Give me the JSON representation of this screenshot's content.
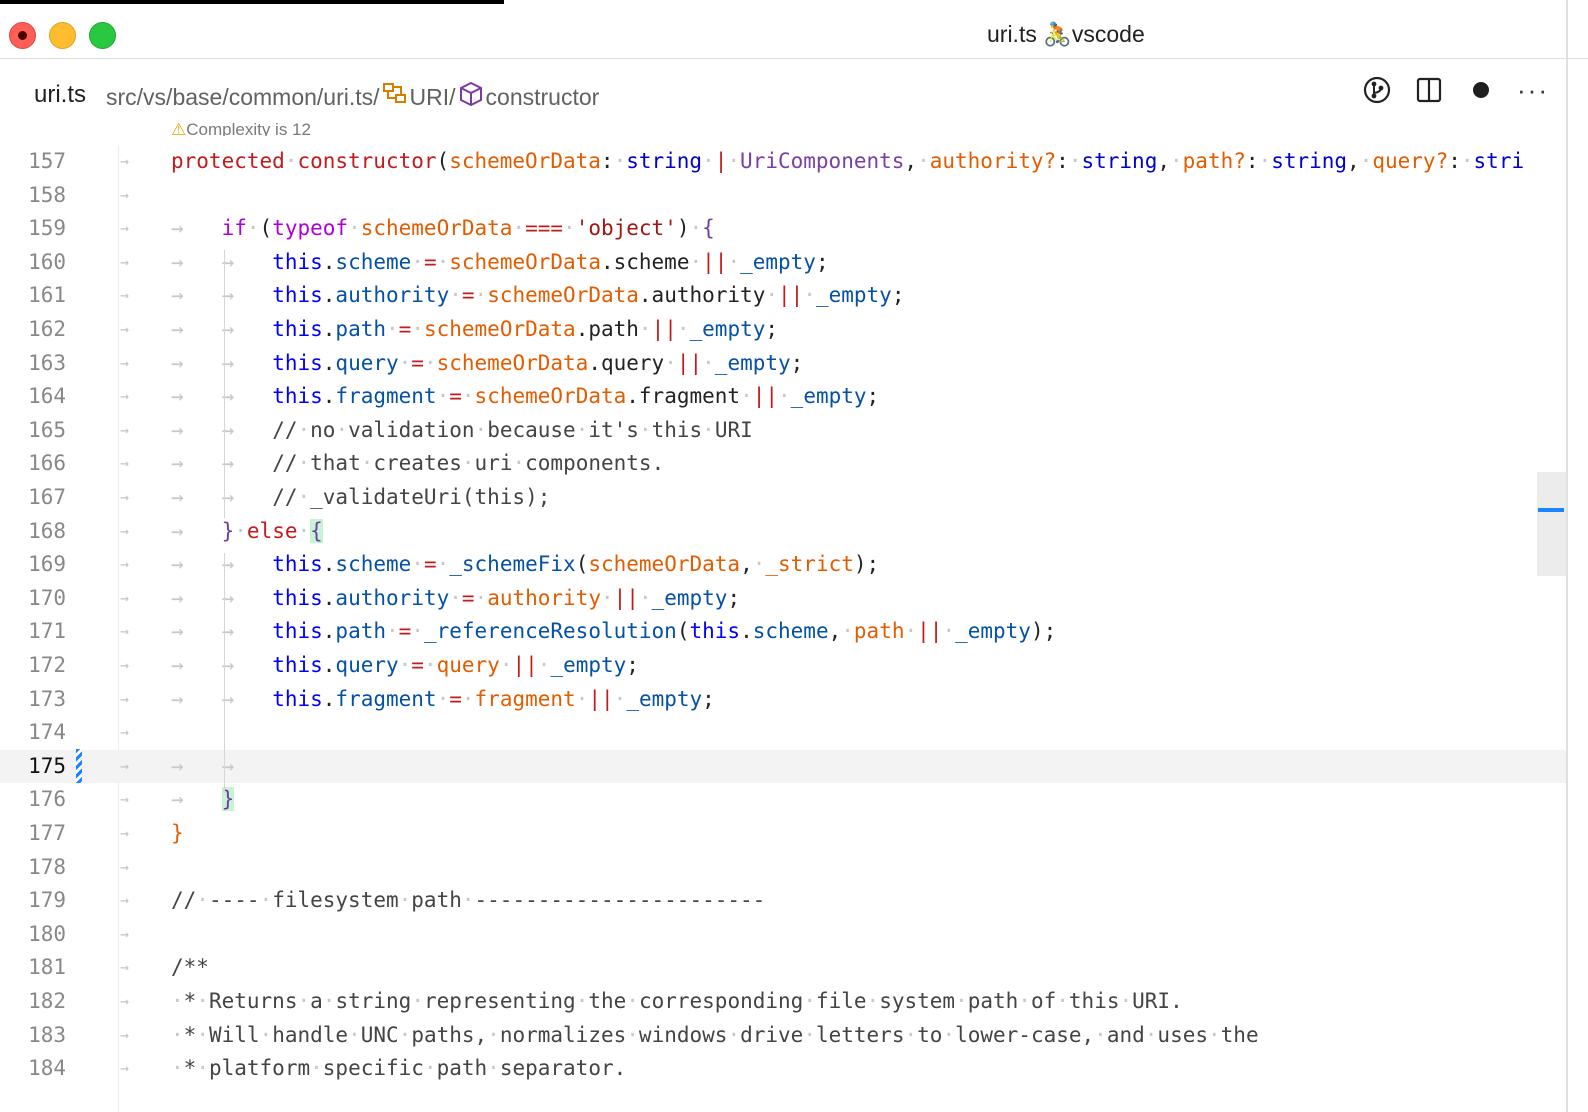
{
  "window": {
    "title": "uri.ts 🚴vscode"
  },
  "tab": {
    "filename": "uri.ts",
    "breadcrumb": {
      "path": "src/vs/base/common/uri.ts/",
      "class_name": "URI/",
      "member_name": "constructor"
    }
  },
  "icons": {
    "breadcrumb_class": "class-icon",
    "breadcrumb_member": "cube-icon",
    "actions": [
      "git-compare-icon",
      "split-editor-icon",
      "unsaved-dot-icon",
      "more-actions-icon"
    ]
  },
  "codelens": "Complexity is 12",
  "editor": {
    "current_line": "175",
    "lines": [
      {
        "n": "157",
        "html": "<span class='kw'>protected</span><span class='ws'>·</span><span class='kw'>constructor</span><span class='d'>(</span><span class='v'>schemeOrData</span><span class='d'>:</span><span class='ws'>·</span><span class='t'>string</span><span class='ws'>·</span><span class='kw'>|</span><span class='ws'>·</span><span class='ty'>UriComponents</span><span class='d'>,</span><span class='ws'>·</span><span class='v'>authority?</span><span class='d'>:</span><span class='ws'>·</span><span class='t'>string</span><span class='d'>,</span><span class='ws'>·</span><span class='v'>path?</span><span class='d'>:</span><span class='ws'>·</span><span class='t'>string</span><span class='d'>,</span><span class='ws'>·</span><span class='v'>query?</span><span class='d'>:</span><span class='ws'>·</span><span class='t'>stri</span>"
      },
      {
        "n": "158",
        "html": ""
      },
      {
        "n": "159",
        "html": "<span class='ws'>→</span>   <span class='k'>if</span><span class='ws'>·</span><span class='d'>(</span><span class='k'>typeof</span><span class='ws'>·</span><span class='v'>schemeOrData</span><span class='ws'>·</span><span class='kw'>===</span><span class='ws'>·</span><span class='s'>'object'</span><span class='d'>)</span><span class='ws'>·</span><span class='br'>{</span>"
      },
      {
        "n": "160",
        "html": "<span class='ws'>→</span>   <span class='ws'>→</span>   <span class='m'>this</span><span class='d'>.</span><span class='p'>scheme</span><span class='ws'>·</span><span class='kw'>=</span><span class='ws'>·</span><span class='v'>schemeOrData</span><span class='d'>.scheme</span><span class='ws'>·</span><span class='kw'>||</span><span class='ws'>·</span><span class='p'>_empty</span><span class='d'>;</span>"
      },
      {
        "n": "161",
        "html": "<span class='ws'>→</span>   <span class='ws'>→</span>   <span class='m'>this</span><span class='d'>.</span><span class='p'>authority</span><span class='ws'>·</span><span class='kw'>=</span><span class='ws'>·</span><span class='v'>schemeOrData</span><span class='d'>.authority</span><span class='ws'>·</span><span class='kw'>||</span><span class='ws'>·</span><span class='p'>_empty</span><span class='d'>;</span>"
      },
      {
        "n": "162",
        "html": "<span class='ws'>→</span>   <span class='ws'>→</span>   <span class='m'>this</span><span class='d'>.</span><span class='p'>path</span><span class='ws'>·</span><span class='kw'>=</span><span class='ws'>·</span><span class='v'>schemeOrData</span><span class='d'>.path</span><span class='ws'>·</span><span class='kw'>||</span><span class='ws'>·</span><span class='p'>_empty</span><span class='d'>;</span>"
      },
      {
        "n": "163",
        "html": "<span class='ws'>→</span>   <span class='ws'>→</span>   <span class='m'>this</span><span class='d'>.</span><span class='p'>query</span><span class='ws'>·</span><span class='kw'>=</span><span class='ws'>·</span><span class='v'>schemeOrData</span><span class='d'>.query</span><span class='ws'>·</span><span class='kw'>||</span><span class='ws'>·</span><span class='p'>_empty</span><span class='d'>;</span>"
      },
      {
        "n": "164",
        "html": "<span class='ws'>→</span>   <span class='ws'>→</span>   <span class='m'>this</span><span class='d'>.</span><span class='p'>fragment</span><span class='ws'>·</span><span class='kw'>=</span><span class='ws'>·</span><span class='v'>schemeOrData</span><span class='d'>.fragment</span><span class='ws'>·</span><span class='kw'>||</span><span class='ws'>·</span><span class='p'>_empty</span><span class='d'>;</span>"
      },
      {
        "n": "165",
        "html": "<span class='ws'>→</span>   <span class='ws'>→</span>   <span class='c'>//</span><span class='ws'>·</span><span class='c'>no</span><span class='ws'>·</span><span class='c'>validation</span><span class='ws'>·</span><span class='c'>because</span><span class='ws'>·</span><span class='c'>it's</span><span class='ws'>·</span><span class='c'>this</span><span class='ws'>·</span><span class='c'>URI</span>"
      },
      {
        "n": "166",
        "html": "<span class='ws'>→</span>   <span class='ws'>→</span>   <span class='c'>//</span><span class='ws'>·</span><span class='c'>that</span><span class='ws'>·</span><span class='c'>creates</span><span class='ws'>·</span><span class='c'>uri</span><span class='ws'>·</span><span class='c'>components.</span>"
      },
      {
        "n": "167",
        "html": "<span class='ws'>→</span>   <span class='ws'>→</span>   <span class='c'>//</span><span class='ws'>·</span><span class='c'>_validateUri(this);</span>"
      },
      {
        "n": "168",
        "html": "<span class='ws'>→</span>   <span class='br'>}</span><span class='ws'>·</span><span class='kw'>else</span><span class='ws'>·</span><span class='br bh'>{</span>"
      },
      {
        "n": "169",
        "html": "<span class='ws'>→</span>   <span class='ws'>→</span>   <span class='m'>this</span><span class='d'>.</span><span class='p'>scheme</span><span class='ws'>·</span><span class='kw'>=</span><span class='ws'>·</span><span class='p'>_schemeFix</span><span class='d'>(</span><span class='v'>schemeOrData</span><span class='d'>,</span><span class='ws'>·</span><span class='v'>_strict</span><span class='d'>);</span>"
      },
      {
        "n": "170",
        "html": "<span class='ws'>→</span>   <span class='ws'>→</span>   <span class='m'>this</span><span class='d'>.</span><span class='p'>authority</span><span class='ws'>·</span><span class='kw'>=</span><span class='ws'>·</span><span class='v'>authority</span><span class='ws'>·</span><span class='kw'>||</span><span class='ws'>·</span><span class='p'>_empty</span><span class='d'>;</span>"
      },
      {
        "n": "171",
        "html": "<span class='ws'>→</span>   <span class='ws'>→</span>   <span class='m'>this</span><span class='d'>.</span><span class='p'>path</span><span class='ws'>·</span><span class='kw'>=</span><span class='ws'>·</span><span class='p'>_referenceResolution</span><span class='d'>(</span><span class='m'>this</span><span class='d'>.</span><span class='p'>scheme</span><span class='d'>,</span><span class='ws'>·</span><span class='v'>path</span><span class='ws'>·</span><span class='kw'>||</span><span class='ws'>·</span><span class='p'>_empty</span><span class='d'>);</span>"
      },
      {
        "n": "172",
        "html": "<span class='ws'>→</span>   <span class='ws'>→</span>   <span class='m'>this</span><span class='d'>.</span><span class='p'>query</span><span class='ws'>·</span><span class='kw'>=</span><span class='ws'>·</span><span class='v'>query</span><span class='ws'>·</span><span class='kw'>||</span><span class='ws'>·</span><span class='p'>_empty</span><span class='d'>;</span>"
      },
      {
        "n": "173",
        "html": "<span class='ws'>→</span>   <span class='ws'>→</span>   <span class='m'>this</span><span class='d'>.</span><span class='p'>fragment</span><span class='ws'>·</span><span class='kw'>=</span><span class='ws'>·</span><span class='v'>fragment</span><span class='ws'>·</span><span class='kw'>||</span><span class='ws'>·</span><span class='p'>_empty</span><span class='d'>;</span>"
      },
      {
        "n": "174",
        "html": ""
      },
      {
        "n": "175",
        "html": "<span class='ws'>→</span>   <span class='ws'>→</span>"
      },
      {
        "n": "176",
        "html": "<span class='ws'>→</span>   <span class='br bh'>}</span>"
      },
      {
        "n": "177",
        "html": "<span class='v'>}</span>"
      },
      {
        "n": "178",
        "html": ""
      },
      {
        "n": "179",
        "html": "<span class='c'>//</span><span class='ws'>·</span><span class='c'>----</span><span class='ws'>·</span><span class='c'>filesystem</span><span class='ws'>·</span><span class='c'>path</span><span class='ws'>·</span><span class='c'>-----------------------</span>"
      },
      {
        "n": "180",
        "html": ""
      },
      {
        "n": "181",
        "html": "<span class='c'>/**</span>"
      },
      {
        "n": "182",
        "html": "<span class='ws'>·</span><span class='c'>*</span><span class='ws'>·</span><span class='c'>Returns</span><span class='ws'>·</span><span class='c'>a</span><span class='ws'>·</span><span class='c'>string</span><span class='ws'>·</span><span class='c'>representing</span><span class='ws'>·</span><span class='c'>the</span><span class='ws'>·</span><span class='c'>corresponding</span><span class='ws'>·</span><span class='c'>file</span><span class='ws'>·</span><span class='c'>system</span><span class='ws'>·</span><span class='c'>path</span><span class='ws'>·</span><span class='c'>of</span><span class='ws'>·</span><span class='c'>this</span><span class='ws'>·</span><span class='c'>URI.</span>"
      },
      {
        "n": "183",
        "html": "<span class='ws'>·</span><span class='c'>*</span><span class='ws'>·</span><span class='c'>Will</span><span class='ws'>·</span><span class='c'>handle</span><span class='ws'>·</span><span class='c'>UNC</span><span class='ws'>·</span><span class='c'>paths,</span><span class='ws'>·</span><span class='c'>normalizes</span><span class='ws'>·</span><span class='c'>windows</span><span class='ws'>·</span><span class='c'>drive</span><span class='ws'>·</span><span class='c'>letters</span><span class='ws'>·</span><span class='c'>to</span><span class='ws'>·</span><span class='c'>lower-case,</span><span class='ws'>·</span><span class='c'>and</span><span class='ws'>·</span><span class='c'>uses</span><span class='ws'>·</span><span class='c'>the</span>"
      },
      {
        "n": "184",
        "html": "<span class='ws'>·</span><span class='c'>*</span><span class='ws'>·</span><span class='c'>platform</span><span class='ws'>·</span><span class='c'>specific</span><span class='ws'>·</span><span class='c'>path</span><span class='ws'>·</span><span class='c'>separator.</span>"
      }
    ]
  }
}
